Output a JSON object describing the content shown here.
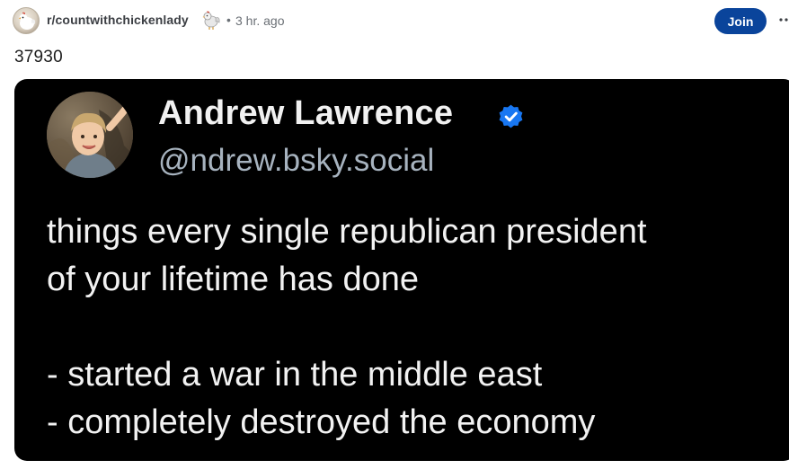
{
  "post_header": {
    "subreddit": "r/countwithchickenlady",
    "separator": "•",
    "time": "3 hr. ago",
    "join_label": "Join"
  },
  "post": {
    "title": "37930"
  },
  "embedded_post": {
    "display_name": "Andrew Lawrence",
    "handle": "@ndrew.bsky.social",
    "lines": [
      "things every single republican president",
      "of your lifetime has done",
      "- started a war in the middle east",
      "- completely destroyed the economy"
    ]
  },
  "colors": {
    "join_button": "#0a449b",
    "verified_badge": "#1877f2",
    "image_background": "#000000"
  },
  "icons": {
    "subreddit_avatar": "chicken-avatar-icon",
    "flair": "chicken-flair-icon",
    "more": "more-options-icon",
    "verified": "verified-check-icon"
  }
}
